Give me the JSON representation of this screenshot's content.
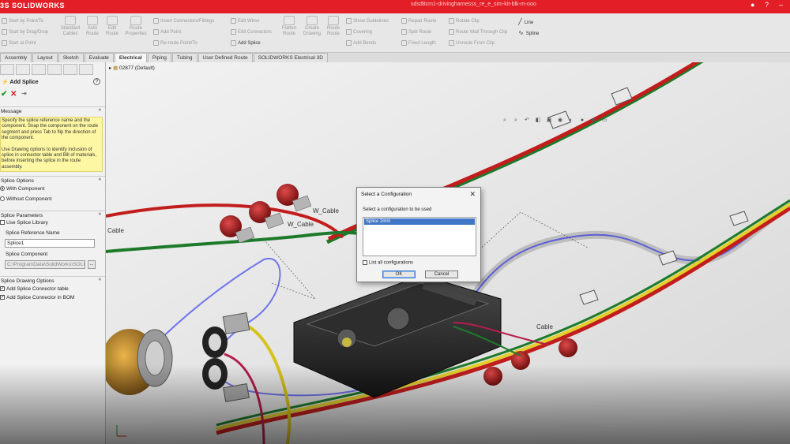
{
  "app": {
    "logo": "3S SOLIDWORKS",
    "document_title": "sdsd8cm1-drivingharnesss_re_e_sim-kit-blk-m-ooo"
  },
  "ribbon": {
    "small_commands": [
      {
        "label": "Start by Point/To"
      },
      {
        "label": "Start by Drag/Drop"
      },
      {
        "label": "Start at Point"
      },
      {
        "label": "Insert Connectors/Fittings"
      },
      {
        "label": "Add Point"
      },
      {
        "label": "Re-route Point/To"
      },
      {
        "label": "Edit Wires"
      },
      {
        "label": "Edit Connectors"
      },
      {
        "label": "Add Splice"
      },
      {
        "label": "Show Guidelines"
      },
      {
        "label": "Covering"
      },
      {
        "label": "Add Bends"
      },
      {
        "label": "Repair Route"
      },
      {
        "label": "Split Route"
      },
      {
        "label": "Fixed Length"
      },
      {
        "label": "Rotate Clip"
      },
      {
        "label": "Route Wall Through Clip"
      },
      {
        "label": "Unroute From Clip"
      },
      {
        "label": "Line"
      },
      {
        "label": "Spline"
      }
    ],
    "big_commands": [
      {
        "label": "Standard Cables"
      },
      {
        "label": "Auto Route"
      },
      {
        "label": "Edit Route"
      },
      {
        "label": "Route Properties"
      },
      {
        "label": "Flatten Route"
      },
      {
        "label": "Create Drawing"
      },
      {
        "label": "Route Route"
      }
    ]
  },
  "tabs": [
    {
      "label": "Assembly"
    },
    {
      "label": "Layout"
    },
    {
      "label": "Sketch"
    },
    {
      "label": "Evaluate"
    },
    {
      "label": "Electrical",
      "active": true
    },
    {
      "label": "Piping"
    },
    {
      "label": "Tubing"
    },
    {
      "label": "User Defined Route"
    },
    {
      "label": "SOLIDWORKS Electrical 3D"
    }
  ],
  "property_manager": {
    "title": "Add Splice",
    "message_header": "Message",
    "message_p1": "Specify the splice reference name and the component. Snap the component on the route segment and press Tab to flip the direction of the component.",
    "message_p2": "Use Drawing options to identify inclusion of splice in connector table and Bill of materials, before inserting the splice in the route assembly.",
    "splice_options_header": "Splice Options",
    "with_component": "With Component",
    "without_component": "Without Component",
    "splice_params_header": "Splice Parameters",
    "use_splice_library": "Use Splice Library",
    "splice_ref_label": "Splice Reference Name",
    "splice_ref_value": "Splice1",
    "splice_component_label": "Splice Component",
    "splice_component_value": "C:\\ProgramData\\SolidWorks\\SOLID",
    "browse_label": "...",
    "drawing_options_header": "Splice Drawing Options",
    "add_connector_table": "Add Splice Connector table",
    "add_connector_bom": "Add Splice Connector in BOM"
  },
  "graphics": {
    "tree_label": "02877 (Default)",
    "cable_labels": [
      {
        "text": "W_Cable"
      },
      {
        "text": "W_Cable"
      },
      {
        "text": "Cable"
      },
      {
        "text": "Cable"
      }
    ]
  },
  "dialog": {
    "title": "Select a Configuration",
    "close": "✕",
    "prompt": "Select a configuration to be used",
    "items": [
      "Splice 2mm"
    ],
    "list_all": "List all configurations",
    "ok": "OK",
    "cancel": "Cancel"
  },
  "colors": {
    "title_bar": "#e41e26",
    "message_bg": "#fdf6a3",
    "selection": "#3f76c6"
  }
}
